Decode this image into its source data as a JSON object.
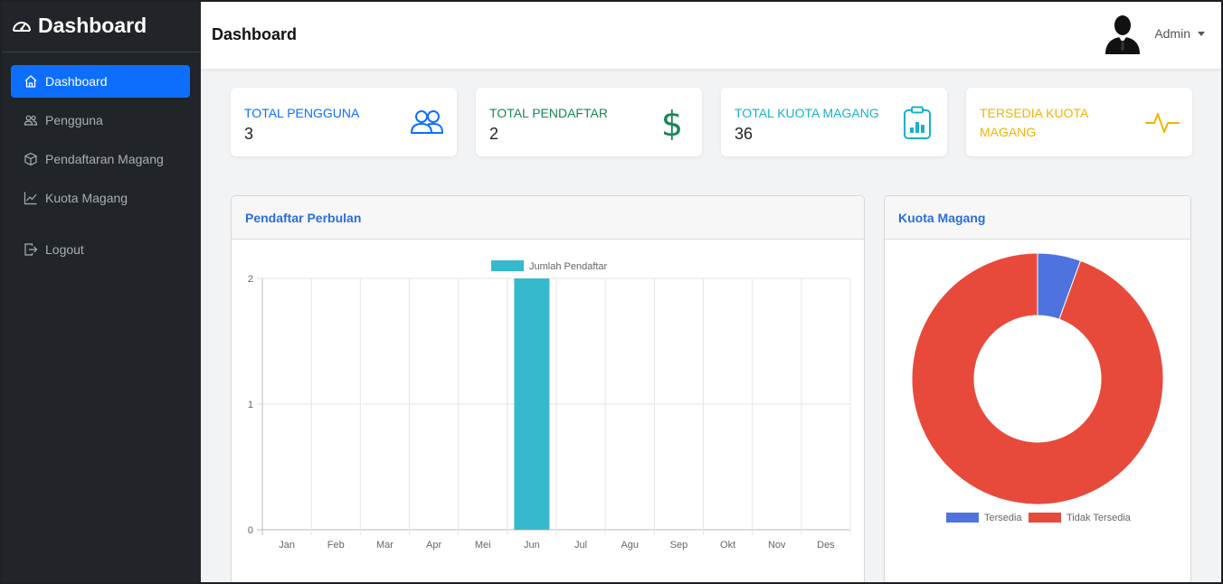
{
  "sidebar": {
    "brand": "Dashboard",
    "items": [
      {
        "label": "Dashboard"
      },
      {
        "label": "Pengguna"
      },
      {
        "label": "Pendaftaran Magang"
      },
      {
        "label": "Kuota Magang"
      },
      {
        "label": "Logout"
      }
    ]
  },
  "header": {
    "title": "Dashboard",
    "user": "Admin"
  },
  "stats": [
    {
      "label": "TOTAL PENGGUNA",
      "value": "3",
      "color": "#0d6efd",
      "icon": "users-icon"
    },
    {
      "label": "TOTAL PENDAFTAR",
      "value": "2",
      "color": "#198754",
      "icon": "dollar-icon"
    },
    {
      "label": "TOTAL KUOTA MAGANG",
      "value": "36",
      "color": "#17b2c8",
      "icon": "clipboard-data-icon"
    },
    {
      "label": "TERSEDIA KUOTA MAGANG",
      "value": "",
      "color": "#f0b400",
      "icon": "activity-icon"
    }
  ],
  "panels": {
    "bar_title": "Pendaftar Perbulan",
    "donut_title": "Kuota Magang"
  },
  "chart_data": [
    {
      "type": "bar",
      "title": "Pendaftar Perbulan",
      "categories": [
        "Jan",
        "Feb",
        "Mar",
        "Apr",
        "Mei",
        "Jun",
        "Jul",
        "Agu",
        "Sep",
        "Okt",
        "Nov",
        "Des"
      ],
      "series": [
        {
          "name": "Jumlah Pendaftar",
          "values": [
            0,
            0,
            0,
            0,
            0,
            2,
            0,
            0,
            0,
            0,
            0,
            0
          ],
          "color": "#36b9cc"
        }
      ],
      "ylim": [
        0,
        2
      ],
      "yticks": [
        0,
        1,
        2
      ],
      "grid": true,
      "legend": "top"
    },
    {
      "type": "pie",
      "title": "Kuota Magang",
      "labels": [
        "Tersedia",
        "Tidak Tersedia"
      ],
      "values": [
        2,
        34
      ],
      "colors": [
        "#4e73df",
        "#e74a3b"
      ],
      "legend": "bottom"
    }
  ]
}
